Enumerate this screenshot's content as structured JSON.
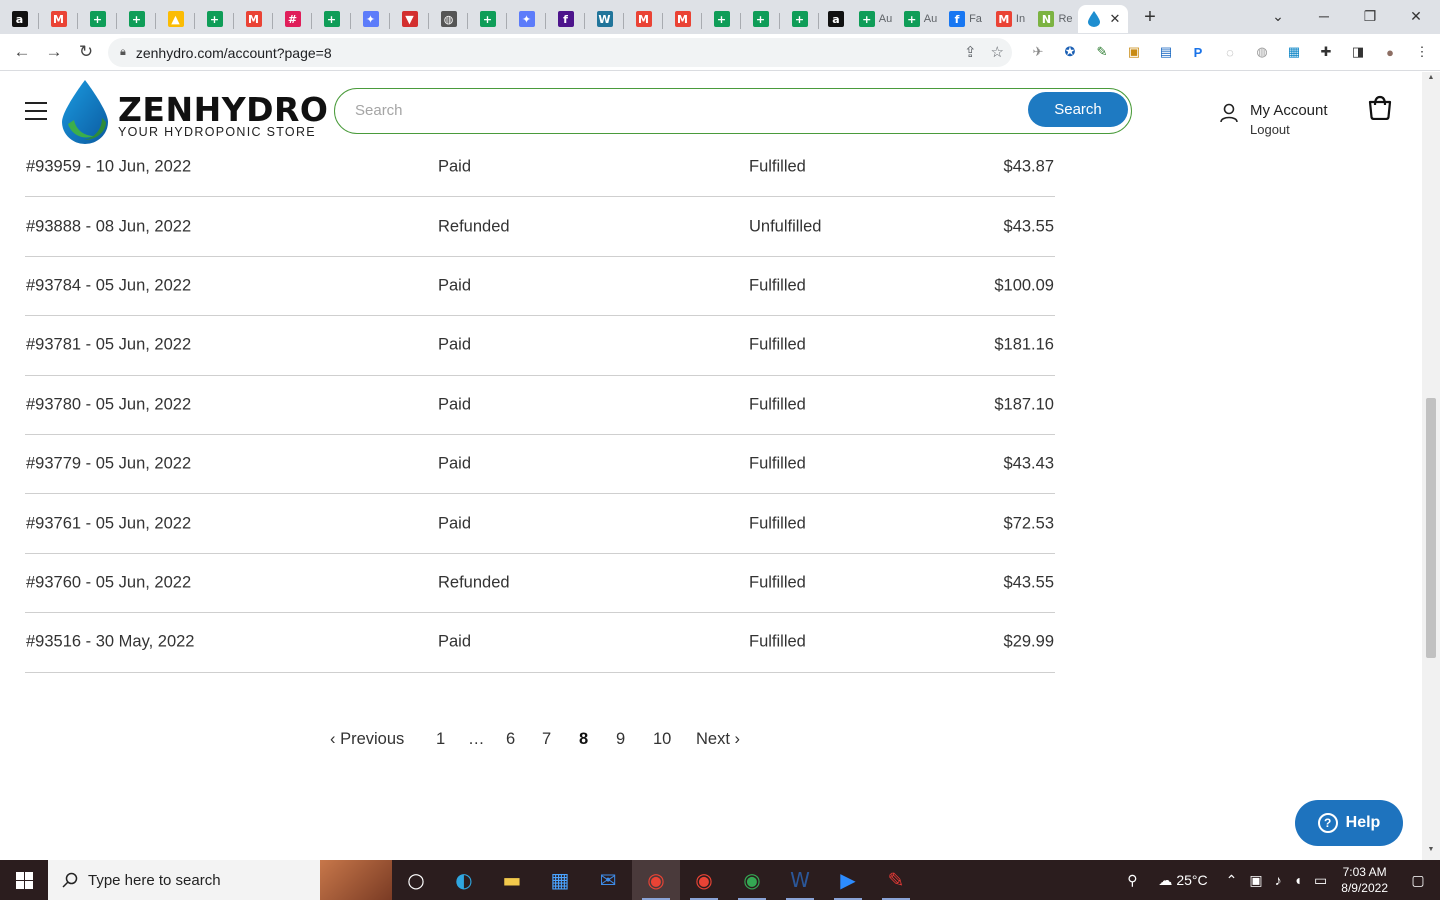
{
  "browser": {
    "tabs": [
      {
        "icon": "amazon-icon",
        "color": "#111111",
        "glyph": "a"
      },
      {
        "icon": "gmail-icon",
        "color": "#ea4335",
        "glyph": "M"
      },
      {
        "icon": "sheets-icon",
        "color": "#0f9d58",
        "glyph": "+"
      },
      {
        "icon": "sheets-icon",
        "color": "#0f9d58",
        "glyph": "+"
      },
      {
        "icon": "drive-icon",
        "color": "#fbbc04",
        "glyph": "▲"
      },
      {
        "icon": "sheets-icon",
        "color": "#0f9d58",
        "glyph": "+"
      },
      {
        "icon": "gmail-icon",
        "color": "#ea4335",
        "glyph": "M"
      },
      {
        "icon": "slack-icon",
        "color": "#e01e5a",
        "glyph": "#"
      },
      {
        "icon": "sheets-icon",
        "color": "#0f9d58",
        "glyph": "+"
      },
      {
        "icon": "app-icon",
        "color": "#5c7cfa",
        "glyph": "✦"
      },
      {
        "icon": "shield-icon",
        "color": "#d32f2f",
        "glyph": "▼"
      },
      {
        "icon": "globe-icon",
        "color": "#555555",
        "glyph": "◍"
      },
      {
        "icon": "sheets-icon",
        "color": "#0f9d58",
        "glyph": "+"
      },
      {
        "icon": "app-icon",
        "color": "#5c7cfa",
        "glyph": "✦"
      },
      {
        "icon": "fedex-icon",
        "color": "#4d148c",
        "glyph": "f"
      },
      {
        "icon": "wordpress-icon",
        "color": "#21759b",
        "glyph": "W"
      },
      {
        "icon": "gmail-icon",
        "color": "#ea4335",
        "glyph": "M"
      },
      {
        "icon": "gmail-icon",
        "color": "#ea4335",
        "glyph": "M"
      },
      {
        "icon": "sheets-icon",
        "color": "#0f9d58",
        "glyph": "+"
      },
      {
        "icon": "sheets-icon",
        "color": "#0f9d58",
        "glyph": "+"
      },
      {
        "icon": "sheets-icon",
        "color": "#0f9d58",
        "glyph": "+"
      }
    ],
    "tabs_with_titles": [
      {
        "icon": "amazon-icon",
        "color": "#111111",
        "glyph": "a",
        "title": ""
      },
      {
        "icon": "sheets-icon",
        "color": "#0f9d58",
        "glyph": "+",
        "title": "Au"
      },
      {
        "icon": "sheets-icon",
        "color": "#0f9d58",
        "glyph": "+",
        "title": "Au"
      },
      {
        "icon": "facebook-icon",
        "color": "#1877f2",
        "glyph": "f",
        "title": "Fa"
      },
      {
        "icon": "gmail-icon",
        "color": "#ea4335",
        "glyph": "M",
        "title": "In"
      },
      {
        "icon": "app-icon",
        "color": "#7cb342",
        "glyph": "N",
        "title": "Re"
      }
    ],
    "active_tab_close": "✕",
    "new_tab": "+",
    "address": "zenhydro.com/account?page=8"
  },
  "site": {
    "logo_name": "ZENHYDRO",
    "logo_tagline": "YOUR HYDROPONIC STORE",
    "search_placeholder": "Search",
    "search_button": "Search",
    "account_label": "My Account",
    "logout_label": "Logout",
    "brand_color": "#1e7ac2",
    "accent_green": "#4a9b3b"
  },
  "orders": [
    {
      "id": "#93959 - 10 Jun, 2022",
      "payment": "Paid",
      "fulfillment": "Fulfilled",
      "total": "$43.87"
    },
    {
      "id": "#93888 - 08 Jun, 2022",
      "payment": "Refunded",
      "fulfillment": "Unfulfilled",
      "total": "$43.55"
    },
    {
      "id": "#93784 - 05 Jun, 2022",
      "payment": "Paid",
      "fulfillment": "Fulfilled",
      "total": "$100.09"
    },
    {
      "id": "#93781 - 05 Jun, 2022",
      "payment": "Paid",
      "fulfillment": "Fulfilled",
      "total": "$181.16"
    },
    {
      "id": "#93780 - 05 Jun, 2022",
      "payment": "Paid",
      "fulfillment": "Fulfilled",
      "total": "$187.10"
    },
    {
      "id": "#93779 - 05 Jun, 2022",
      "payment": "Paid",
      "fulfillment": "Fulfilled",
      "total": "$43.43"
    },
    {
      "id": "#93761 - 05 Jun, 2022",
      "payment": "Paid",
      "fulfillment": "Fulfilled",
      "total": "$72.53"
    },
    {
      "id": "#93760 - 05 Jun, 2022",
      "payment": "Refunded",
      "fulfillment": "Fulfilled",
      "total": "$43.55"
    },
    {
      "id": "#93516 - 30 May, 2022",
      "payment": "Paid",
      "fulfillment": "Fulfilled",
      "total": "$29.99"
    }
  ],
  "pagination": {
    "previous": "‹ Previous",
    "pages": [
      "1",
      "…",
      "6",
      "7",
      "8",
      "9",
      "10"
    ],
    "current": "8",
    "next": "Next ›"
  },
  "help": {
    "label": "Help",
    "glyph": "?"
  },
  "taskbar": {
    "search_placeholder": "Type here to search",
    "weather": "25°C",
    "time": "7:03 AM",
    "date": "8/9/2022",
    "apps": [
      {
        "name": "task-view-icon",
        "glyph": "○",
        "color": "#ffffff",
        "state": ""
      },
      {
        "name": "edge-icon",
        "glyph": "◐",
        "color": "#2fa6e0",
        "state": ""
      },
      {
        "name": "file-explorer-icon",
        "glyph": "▬",
        "color": "#f2c94c",
        "state": ""
      },
      {
        "name": "store-icon",
        "glyph": "▦",
        "color": "#4aa3ff",
        "state": ""
      },
      {
        "name": "mail-icon",
        "glyph": "✉",
        "color": "#3e8ce8",
        "state": ""
      },
      {
        "name": "chrome-icon",
        "glyph": "◉",
        "color": "#ea4335",
        "state": "active"
      },
      {
        "name": "chrome-icon",
        "glyph": "◉",
        "color": "#ea4335",
        "state": "running"
      },
      {
        "name": "chrome-icon",
        "glyph": "◉",
        "color": "#34a853",
        "state": "running"
      },
      {
        "name": "word-icon",
        "glyph": "W",
        "color": "#2b579a",
        "state": "running"
      },
      {
        "name": "zoom-icon",
        "glyph": "▶",
        "color": "#2d8cff",
        "state": "running"
      },
      {
        "name": "paint-icon",
        "glyph": "✎",
        "color": "#e53935",
        "state": "running"
      }
    ]
  }
}
